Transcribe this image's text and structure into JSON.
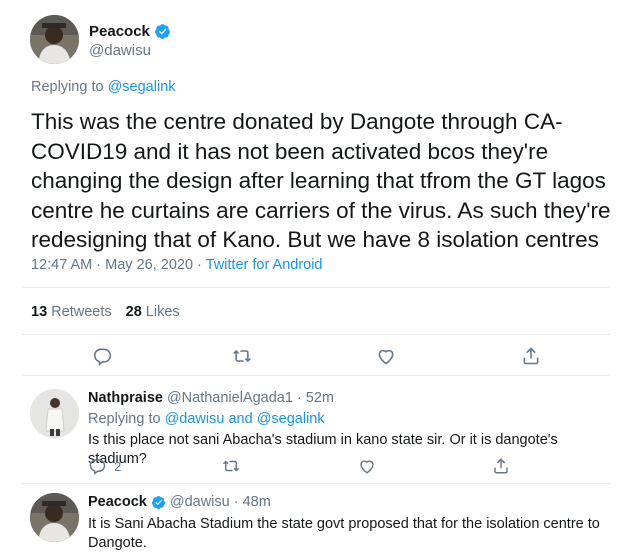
{
  "main_tweet": {
    "display_name": "Peacock",
    "handle": "@dawisu",
    "replying_prefix": "Replying to",
    "replying_to": "@segalink",
    "text": "This was the centre donated by Dangote through CA-COVID19 and it has not been activated bcos they're changing the design after learning that tfrom the GT lagos centre he curtains are carriers of the virus. As such they're redesigning that of Kano. But we have 8 isolation centres",
    "timestamp": "12:47 AM · May 26, 2020 · ",
    "source": "Twitter for Android",
    "retweets_count": "13",
    "retweets_label": "Retweets",
    "likes_count": "28",
    "likes_label": "Likes"
  },
  "replies": [
    {
      "display_name": "Nathpraise",
      "handle": "@NathanielAgada1",
      "time": " · 52m",
      "replying_prefix": "Replying to",
      "replying_to_1": "@dawisu",
      "replying_and": "and",
      "replying_to_2": "@segalink",
      "text": "Is this place not sani Abacha's stadium in kano state sir. Or it is dangote's stadium?",
      "reply_count": "2"
    },
    {
      "display_name": "Peacock",
      "handle": "@dawisu",
      "time": " · 48m",
      "text": "It is Sani Abacha Stadium the state govt proposed that for the isolation centre to Dangote."
    }
  ],
  "colors": {
    "link": "#1b95e0",
    "secondary": "#657786",
    "primary": "#14171a",
    "verified": "#1da1f2",
    "divider": "#e6ecf0"
  },
  "icons": [
    "verified-badge-icon",
    "reply-icon",
    "retweet-icon",
    "like-icon",
    "share-icon"
  ]
}
